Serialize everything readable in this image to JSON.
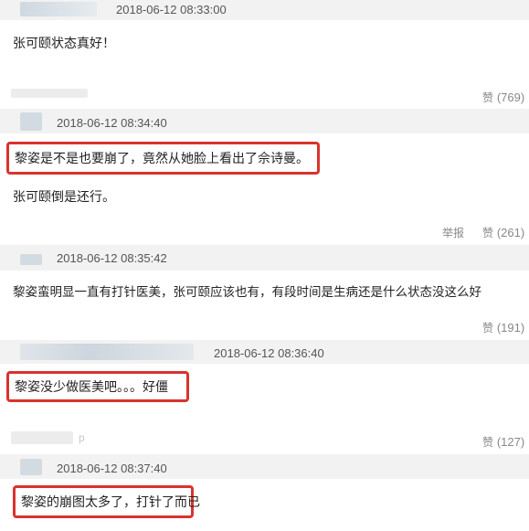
{
  "comments": [
    {
      "timestamp": "2018-06-12 08:33:00",
      "text": "张可颐状态真好！",
      "like_label": "赞",
      "like_count": "(769)"
    },
    {
      "timestamp": "2018-06-12 08:34:40",
      "highlighted_text": "黎姿是不是也要崩了，竟然从她脸上看出了佘诗曼。",
      "text": "张可颐倒是还行。",
      "report_label": "举报",
      "like_label": "赞",
      "like_count": "(261)"
    },
    {
      "timestamp": "2018-06-12 08:35:42",
      "text": "黎姿蛮明显一直有打针医美，张可颐应该也有，有段时间是生病还是什么状态没这么好",
      "like_label": "赞",
      "like_count": "(191)"
    },
    {
      "timestamp": "2018-06-12 08:36:40",
      "highlighted_text": "黎姿没少做医美吧。。。好僵",
      "like_label": "赞",
      "like_count": "(127)"
    },
    {
      "timestamp": "2018-06-12 08:37:40",
      "highlighted_text": "黎姿的崩图太多了，打针了而已"
    }
  ],
  "username_fragment": "p",
  "colors": {
    "highlight_border": "#d9332e",
    "band_bg": "#f2f2f2",
    "blur": "#d7dee4"
  }
}
